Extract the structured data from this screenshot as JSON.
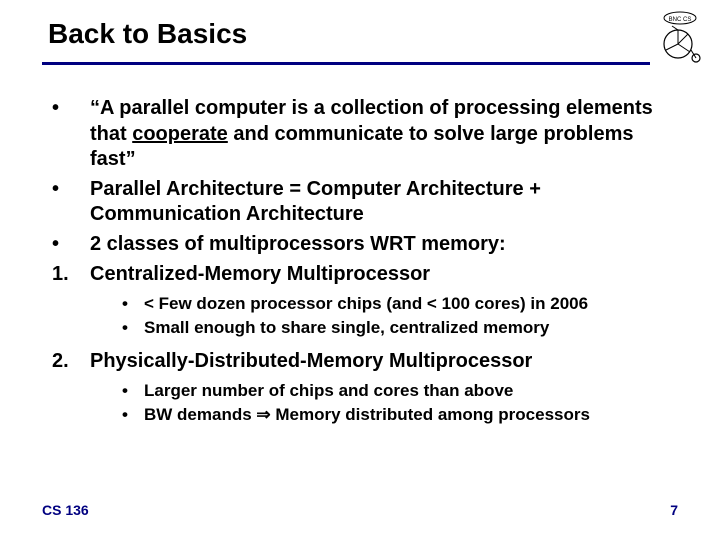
{
  "title": "Back to Basics",
  "bullets": {
    "b1": "“A parallel computer is a collection of processing elements that ",
    "b1_underlined": "cooperate",
    "b1_after": " and communicate to solve large problems fast”",
    "b2": "Parallel Architecture = Computer Architecture + Communication Architecture",
    "b3": "2 classes of multiprocessors WRT memory:",
    "n1": "Centralized-Memory Multiprocessor",
    "n1_sub1": "< Few dozen processor chips (and < 100 cores) in 2006",
    "n1_sub2": "Small enough to share single, centralized memory",
    "n2": "Physically-Distributed-Memory Multiprocessor",
    "n2_sub1": "Larger number of chips and cores than above",
    "n2_sub2_a": "BW demands ",
    "n2_sub2_b": " Memory distributed among processors"
  },
  "markers": {
    "dot": "•",
    "one": "1.",
    "two": "2.",
    "arrow": "⇒"
  },
  "logo_text": "BNC CS",
  "footer": {
    "course": "CS 136",
    "page": "7"
  }
}
